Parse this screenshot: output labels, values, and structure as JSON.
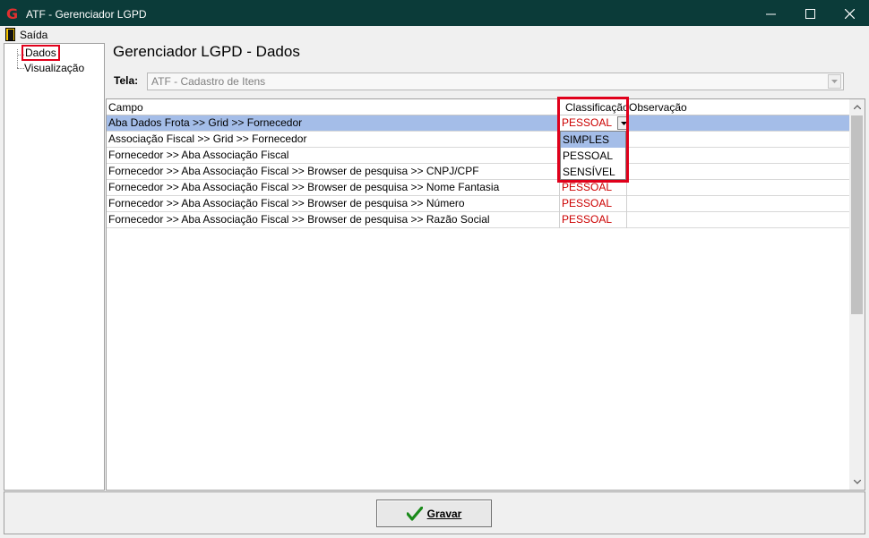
{
  "window": {
    "title": "ATF - Gerenciador LGPD",
    "app_icon": "G-logo-icon",
    "minimize_icon": "minimize-icon",
    "maximize_icon": "maximize-icon",
    "close_icon": "close-icon"
  },
  "menu": {
    "exit_label": "Saída",
    "exit_icon": "exit-door-icon"
  },
  "tree": {
    "items": [
      {
        "label": "Dados",
        "highlighted": true
      },
      {
        "label": "Visualização",
        "highlighted": false
      }
    ]
  },
  "panel": {
    "title": "Gerenciador LGPD - Dados",
    "tela_label": "Tela:",
    "tela_value": "ATF - Cadastro de Itens"
  },
  "grid": {
    "columns": [
      "Campo",
      "Classificação",
      "Observação"
    ],
    "rows": [
      {
        "campo": "Aba Dados Frota >> Grid >> Fornecedor",
        "classificacao": "PESSOAL",
        "observacao": "",
        "selected": true
      },
      {
        "campo": "Associação Fiscal >> Grid >> Fornecedor",
        "classificacao": "",
        "observacao": ""
      },
      {
        "campo": "Fornecedor >> Aba Associação Fiscal",
        "classificacao": "",
        "observacao": ""
      },
      {
        "campo": "Fornecedor >> Aba Associação Fiscal >> Browser de pesquisa >> CNPJ/CPF",
        "classificacao": "",
        "observacao": ""
      },
      {
        "campo": "Fornecedor >> Aba Associação Fiscal >> Browser de pesquisa >> Nome Fantasia",
        "classificacao": "PESSOAL",
        "observacao": ""
      },
      {
        "campo": "Fornecedor >> Aba Associação Fiscal >> Browser de pesquisa >> Número",
        "classificacao": "PESSOAL",
        "observacao": ""
      },
      {
        "campo": "Fornecedor >> Aba Associação Fiscal >> Browser de pesquisa >> Razão Social",
        "classificacao": "PESSOAL",
        "observacao": ""
      }
    ],
    "dropdown_options": [
      "SIMPLES",
      "PESSOAL",
      "SENSÍVEL"
    ],
    "dropdown_active": "SIMPLES",
    "classification_color": "#cc0000",
    "selection_color": "#a4bde8",
    "highlight_color": "#e0001b"
  },
  "footer": {
    "save_label": "Gravar",
    "save_icon": "checkmark-icon"
  }
}
